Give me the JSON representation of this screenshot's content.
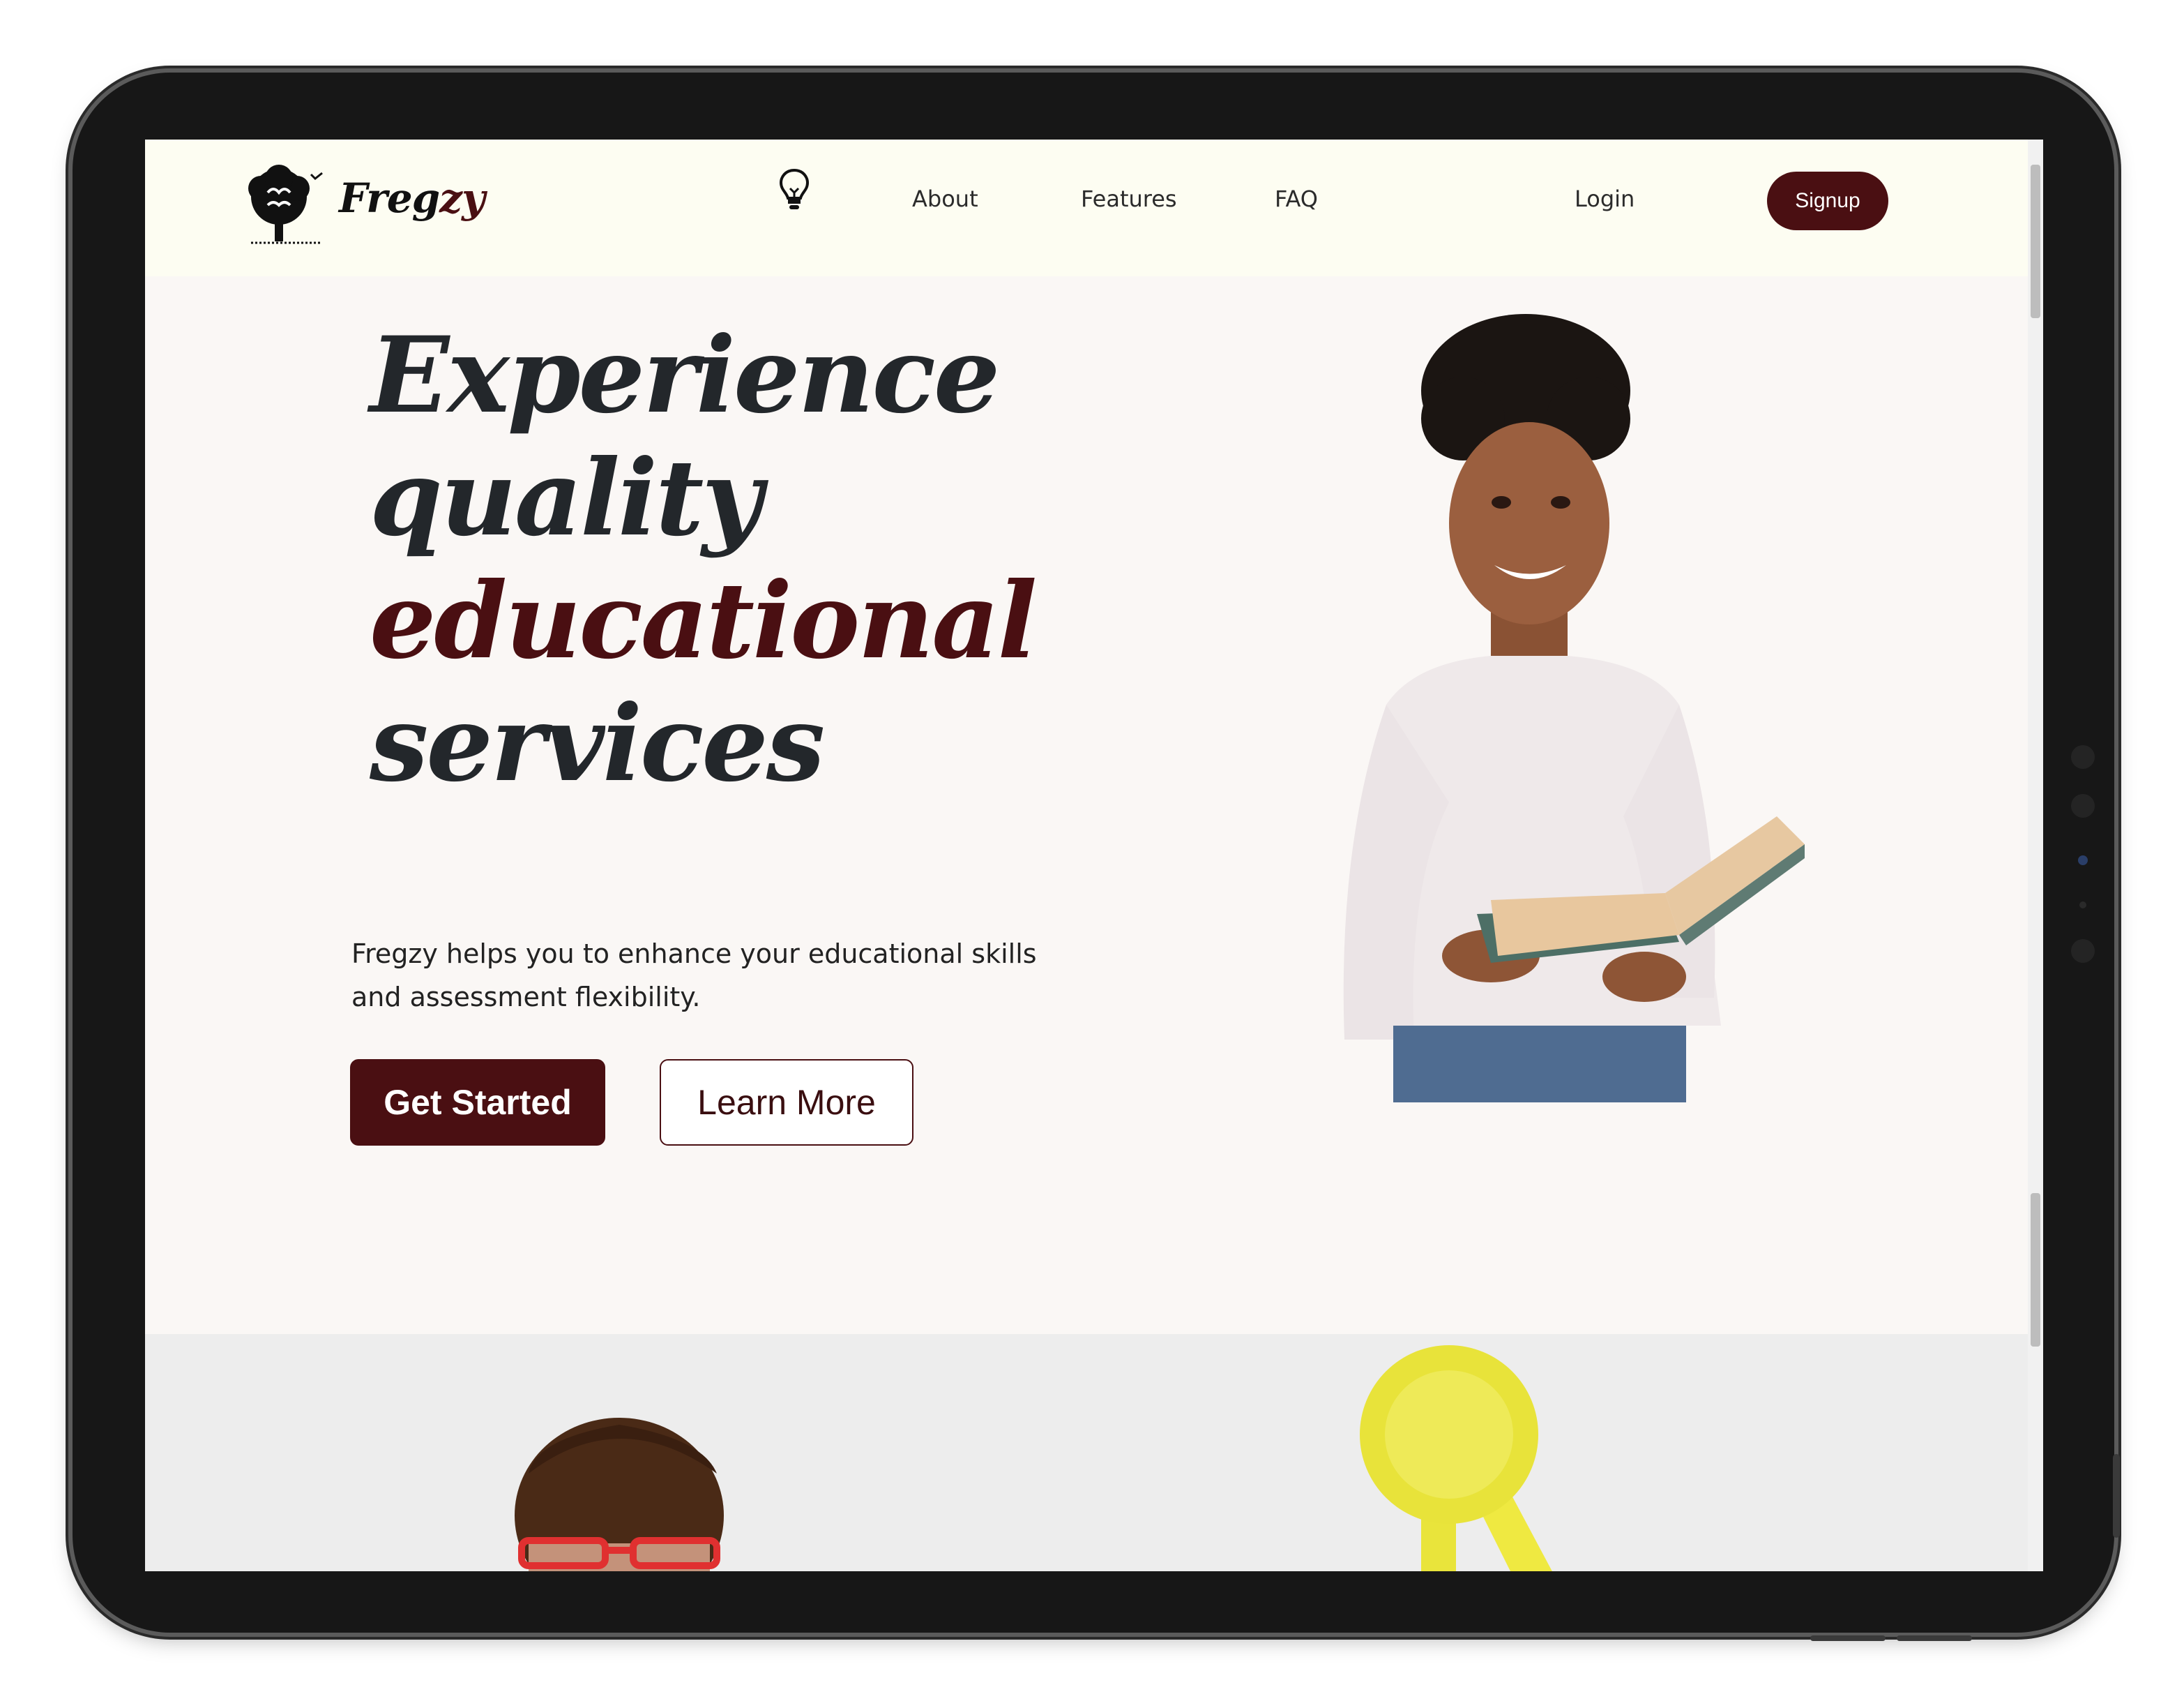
{
  "brand": {
    "name_main": "Freg",
    "name_accent": "zy",
    "accent_color": "#4a0f12"
  },
  "nav": {
    "idea_icon": "lightbulb-icon",
    "links": [
      "About",
      "Features",
      "FAQ"
    ],
    "login": "Login",
    "signup": "Signup"
  },
  "hero": {
    "title_line1": "Experience",
    "title_line2": "quality",
    "title_line3": "educational",
    "title_line4": "services",
    "subtitle": "Fregzy helps you to enhance your educational skills and assessment flexibility.",
    "primary_button": "Get Started",
    "secondary_button": "Learn More",
    "image": "woman-holding-book-photo"
  },
  "next_section": {
    "left_image": "man-with-red-glasses-photo",
    "right_image": "yellow-award-ribbon"
  },
  "colors": {
    "header_bg": "#fdfdf2",
    "page_bg": "#faf7f5",
    "section_bg": "#ededed",
    "title_text": "#23272b"
  }
}
